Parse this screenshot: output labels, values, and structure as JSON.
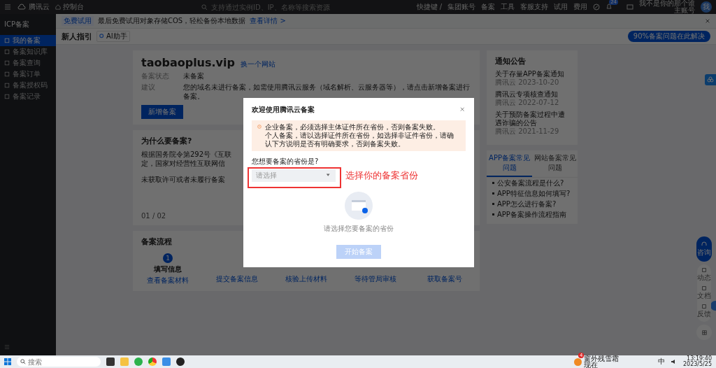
{
  "topbar": {
    "brand": "腾讯云",
    "console": "控制台",
    "search": {
      "placeholder": "支持通过实例ID、IP、名称等搜索资源"
    },
    "shortcut": "快捷键 /",
    "nav": [
      "集团账号",
      "备案",
      "工具",
      "客服支持",
      "试用",
      "费用"
    ],
    "bell_badge": "24",
    "account": {
      "name": "我不是你的那个谁",
      "role": "主账号",
      "avatar": "我"
    }
  },
  "sidebar": {
    "title": "ICP备案",
    "items": [
      {
        "label": "我的备案",
        "selected": true
      },
      {
        "label": "备案知识库",
        "selected": false
      },
      {
        "label": "备案查询",
        "selected": false
      },
      {
        "label": "备案订单",
        "selected": false
      },
      {
        "label": "备案授权码",
        "selected": false
      },
      {
        "label": "备案记录",
        "selected": false
      }
    ]
  },
  "banner": {
    "tag": "免费试用",
    "text": "最后免费试用对象存储COS，轻松备份本地数据",
    "link": "查看详情 >"
  },
  "header": {
    "title": "新人指引",
    "assistant": "AI助手",
    "help": "90%备案问题在此解决"
  },
  "site": {
    "domain": "taobaoplus.vip",
    "switch": "换一个网站",
    "rows": [
      {
        "label": "备案状态",
        "value": "未备案"
      },
      {
        "label": "建议",
        "value": "您的域名未进行备案，如需使用腾讯云服务（域名解析、云服务器等），请点击新增备案进行备案。"
      }
    ],
    "button": "新增备案"
  },
  "why": {
    "title": "为什么要备案?",
    "lines": [
      "根据国务院令第292号《互联",
      "定，国家对经营性互联网信",
      "未获取许可或者未履行备案"
    ],
    "pager": "01 / 02"
  },
  "process": {
    "title": "备案流程",
    "steps": [
      {
        "number": "1",
        "title": "填写信息",
        "link": "查看备案材料"
      },
      {
        "link": "提交备案信息"
      },
      {
        "link": "核验上传材料"
      },
      {
        "link": "等待管局审核"
      },
      {
        "link": "获取备案号"
      }
    ]
  },
  "notices": {
    "title": "通知公告",
    "items": [
      {
        "title": "关于存量APP备案通知",
        "meta": "腾讯云 2023-10-20"
      },
      {
        "title": "腾讯云专项核查通知",
        "meta": "腾讯云 2022-07-12"
      },
      {
        "title": "关于预防备案过程中遭遇诈骗的公告",
        "meta": "腾讯云 2021-11-29"
      }
    ]
  },
  "faq": {
    "tabs": [
      {
        "label": "APP备案常见问题",
        "selected": true
      },
      {
        "label": "网站备案常见问题",
        "selected": false
      }
    ],
    "items": [
      "公安备案流程是什么?",
      "APP特征信息如何填写?",
      "APP怎么进行备案?",
      "APP备案操作流程指南"
    ]
  },
  "rail": {
    "consult": "咨询",
    "items": [
      "动态",
      "文档",
      "反馈"
    ]
  },
  "modal": {
    "title": "欢迎使用腾讯云备案",
    "warnings": [
      "企业备案，必须选择主体证件所在省份，否则备案失败。",
      "个人备案，请以选择证件所在省份，如选择非证件省份，请确认下方说明是否有明确要求，否则备案失败。"
    ],
    "label": "您想要备案的省份是?",
    "select": {
      "placeholder": "请选择"
    },
    "annotation": "选择你的备案省份",
    "empty": "请选择您要备案的省份",
    "button": {
      "label": "开始备案",
      "disabled": true
    }
  },
  "taskbar": {
    "search": {
      "placeholder": "搜索"
    },
    "weather": {
      "badge": "4",
      "title": "窗外残雪霜",
      "sub": "现在"
    },
    "ime": "中",
    "time": "13:19:40",
    "date": "2023/5/25"
  }
}
